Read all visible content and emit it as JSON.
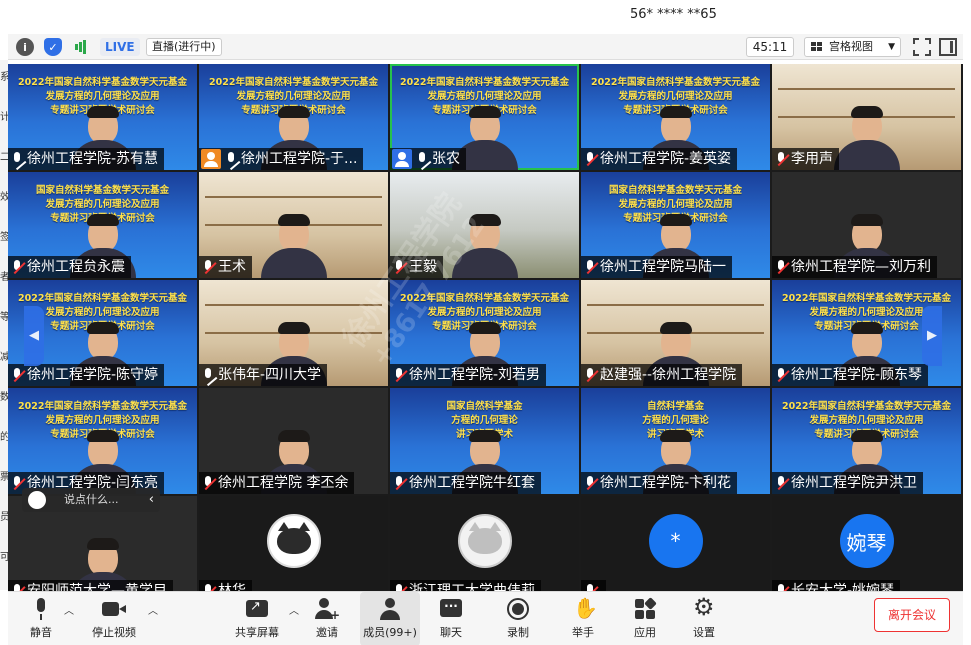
{
  "window": {
    "title": "56* **** **65"
  },
  "toolbar": {
    "live_label": "LIVE",
    "live_status": "直播(进行中)",
    "timer": "45:11",
    "view_mode": "宫格视图"
  },
  "left_edge_chars": [
    "系",
    "计",
    "二",
    "效",
    "签",
    "者",
    "等",
    "减",
    "数",
    "的",
    "票",
    "员",
    "可"
  ],
  "tiles": [
    {
      "name": "徐州工程学院-苏有慧",
      "mic": "on",
      "background": "banner",
      "banner_lines": [
        "2022年国家自然科学基金数学天元基金",
        "发展方程的几何理论及应用",
        "专题讲习班暨学术研讨会"
      ]
    },
    {
      "name": "徐州工程学院-于...",
      "mic": "on",
      "badge": "orange",
      "background": "banner",
      "banner_lines": [
        "2022年国家自然科学基金数学天元基金",
        "发展方程的几何理论及应用",
        "专题讲习班暨学术研讨会"
      ]
    },
    {
      "name": "张农",
      "mic": "on",
      "badge": "blue",
      "active": true,
      "background": "banner",
      "banner_lines": [
        "2022年国家自然科学基金数学天元基金",
        "发展方程的几何理论及应用",
        "专题讲习班暨学术研讨会"
      ]
    },
    {
      "name": "徐州工程学院-姜英姿",
      "mic": "off",
      "background": "banner",
      "banner_lines": [
        "2022年国家自然科学基金数学天元基金",
        "发展方程的几何理论及应用",
        "专题讲习班暨学术研讨会"
      ]
    },
    {
      "name": "李用声",
      "mic": "off",
      "background": "room"
    },
    {
      "name": "徐州工程贠永震",
      "mic": "off",
      "background": "banner",
      "banner_lines": [
        "国家自然科学基金数学天元基金",
        "发展方程的几何理论及应用",
        "专题讲习班暨学术研讨会"
      ]
    },
    {
      "name": "王术",
      "mic": "off",
      "background": "room"
    },
    {
      "name": "王毅",
      "mic": "off",
      "background": "city"
    },
    {
      "name": "徐州工程学院马陆一",
      "mic": "off",
      "background": "banner",
      "banner_lines": [
        "国家自然科学基金数学天元基金",
        "发展方程的几何理论及应用",
        "专题讲习班暨学术研讨会"
      ]
    },
    {
      "name": "徐州工程学院—刘万利",
      "mic": "off",
      "background": "dark"
    },
    {
      "name": "徐州工程学院-陈守婷",
      "mic": "off",
      "background": "banner",
      "banner_lines": [
        "2022年国家自然科学基金数学天元基金",
        "发展方程的几何理论及应用",
        "专题讲习班暨学术研讨会"
      ]
    },
    {
      "name": "张伟年-四川大学",
      "mic": "on",
      "background": "room"
    },
    {
      "name": "徐州工程学院-刘若男",
      "mic": "off",
      "background": "banner",
      "banner_lines": [
        "2022年国家自然科学基金数学天元基金",
        "发展方程的几何理论及应用",
        "专题讲习班暨学术研讨会"
      ]
    },
    {
      "name": "赵建强--徐州工程学院",
      "mic": "off",
      "background": "room"
    },
    {
      "name": "徐州工程学院-顾东琴",
      "mic": "off",
      "background": "banner",
      "banner_lines": [
        "2022年国家自然科学基金数学天元基金",
        "发展方程的几何理论及应用",
        "专题讲习班暨学术研讨会"
      ]
    },
    {
      "name": "徐州工程学院-闫东亮",
      "mic": "off",
      "background": "banner",
      "banner_lines": [
        "2022年国家自然科学基金数学天元基金",
        "发展方程的几何理论及应用",
        "专题讲习班暨学术研讨会"
      ]
    },
    {
      "name": "徐州工程学院 李丕余",
      "mic": "off",
      "background": "dark"
    },
    {
      "name": "徐州工程学院牛红套",
      "mic": "off",
      "background": "banner",
      "banner_lines": [
        "国家自然科学基金",
        "方程的几何理论",
        "讲习班暨学术"
      ]
    },
    {
      "name": "徐州工程学院-卞利花",
      "mic": "off",
      "background": "banner",
      "banner_lines": [
        "自然科学基金",
        "方程的几何理论",
        "讲习班暨学术"
      ]
    },
    {
      "name": "徐州工程学院尹洪卫",
      "mic": "off",
      "background": "banner",
      "banner_lines": [
        "2022年国家自然科学基金数学天元基金",
        "发展方程的几何理论及应用",
        "专题讲习班暨学术研讨会"
      ]
    },
    {
      "name": "安阳师范大学—黄学目",
      "mic": "off",
      "background": "dark"
    },
    {
      "name": "林华",
      "mic": "off",
      "background": "avatar",
      "avatar": "cat-dark"
    },
    {
      "name": "浙江理工大学曲伟莉",
      "mic": "off",
      "background": "avatar",
      "avatar": "cat-gray"
    },
    {
      "name": "",
      "mic": "off",
      "background": "avatar",
      "avatar_text": "*"
    },
    {
      "name": "长安大学-姚婉琴",
      "mic": "off",
      "background": "avatar",
      "avatar_text": "婉琴"
    }
  ],
  "chat_overlay": {
    "placeholder": "说点什么..."
  },
  "watermark": {
    "line1": "徐州工程学院",
    "line2": "+8617    7612"
  },
  "controls": [
    {
      "id": "mute",
      "label": "静音",
      "icon": "microphone-icon",
      "has_arrow": true
    },
    {
      "id": "stop-video",
      "label": "停止视频",
      "icon": "camera-icon",
      "has_arrow": true
    },
    {
      "id": "share",
      "label": "共享屏幕",
      "icon": "share-screen-icon",
      "has_arrow": true
    },
    {
      "id": "invite",
      "label": "邀请",
      "icon": "invite-icon"
    },
    {
      "id": "members",
      "label": "成员(99+)",
      "icon": "members-icon"
    },
    {
      "id": "chat",
      "label": "聊天",
      "icon": "chat-icon"
    },
    {
      "id": "record",
      "label": "录制",
      "icon": "record-icon"
    },
    {
      "id": "raise-hand",
      "label": "举手",
      "icon": "hand-icon"
    },
    {
      "id": "apps",
      "label": "应用",
      "icon": "apps-icon"
    },
    {
      "id": "settings",
      "label": "设置",
      "icon": "gear-icon"
    }
  ],
  "leave_button": "离开会议"
}
